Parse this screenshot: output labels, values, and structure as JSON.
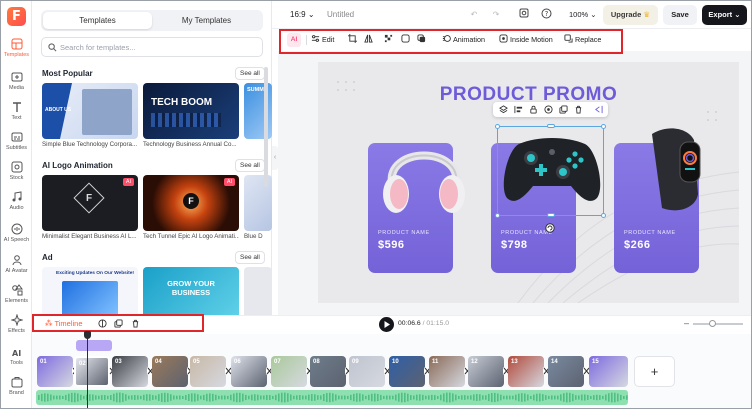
{
  "rail": {
    "items": [
      {
        "label": "Templates",
        "icon": "template-icon",
        "active": true
      },
      {
        "label": "Media",
        "icon": "media-icon"
      },
      {
        "label": "Text",
        "icon": "text-icon"
      },
      {
        "label": "Subtitles",
        "icon": "subtitles-icon"
      },
      {
        "label": "Stock",
        "icon": "stock-icon"
      },
      {
        "label": "Audio",
        "icon": "audio-icon"
      },
      {
        "label": "AI Speech",
        "icon": "ai-speech-icon"
      },
      {
        "label": "AI Avatar",
        "icon": "ai-avatar-icon"
      },
      {
        "label": "Elements",
        "icon": "elements-icon"
      },
      {
        "label": "Effects",
        "icon": "effects-icon"
      },
      {
        "label": "Tools",
        "icon": "tools-icon"
      },
      {
        "label": "Brand",
        "icon": "brand-icon"
      }
    ]
  },
  "panel": {
    "tabs": [
      "Templates",
      "My Templates"
    ],
    "search_placeholder": "Search for templates...",
    "see_all": "See all",
    "sections": [
      {
        "title": "Most Popular",
        "items": [
          "Simple Blue Technology Corpora...",
          "Technology Business Annual Co..."
        ],
        "overlay_texts": [
          "ABOUT US",
          "TECH BOOM",
          "SUMM"
        ]
      },
      {
        "title": "AI Logo Animation",
        "items": [
          "Minimalist Elegant Business AI L...",
          "Tech Tunnel Epic AI Logo Animati..."
        ],
        "extra": "Blue D",
        "badge": "AI"
      },
      {
        "title": "Ad",
        "items": [],
        "overlay_texts": [
          "Exciting Updates On Our Website!",
          "GROW YOUR BUSINESS"
        ]
      }
    ]
  },
  "header": {
    "ratio": "16:9",
    "title": "Untitled",
    "zoom": "100%",
    "upgrade": "Upgrade",
    "save": "Save",
    "export": "Export"
  },
  "toolbar": {
    "ai": "AI",
    "edit": "Edit",
    "animation": "Animation",
    "inside_motion": "Inside Motion",
    "replace": "Replace"
  },
  "canvas": {
    "title": "PRODUCT PROMO",
    "cards": [
      {
        "name": "PRODUCT NAME",
        "price": "$596"
      },
      {
        "name": "PRODUCT NAME",
        "price": "$798"
      },
      {
        "name": "PRODUCT NAME",
        "price": "$266"
      }
    ]
  },
  "timeline": {
    "label": "Timeline",
    "current": "00:06.6",
    "total": "/ 01:15.0",
    "clip_numbers": [
      "01",
      "02",
      "03",
      "04",
      "05",
      "06",
      "07",
      "08",
      "09",
      "10",
      "11",
      "12",
      "13",
      "14",
      "15"
    ],
    "add": "+"
  },
  "colors": {
    "accent": "#ff5a36",
    "purple": "#7462d8",
    "highlight_red": "#e0252b",
    "audio_green": "#8fe0b0"
  }
}
